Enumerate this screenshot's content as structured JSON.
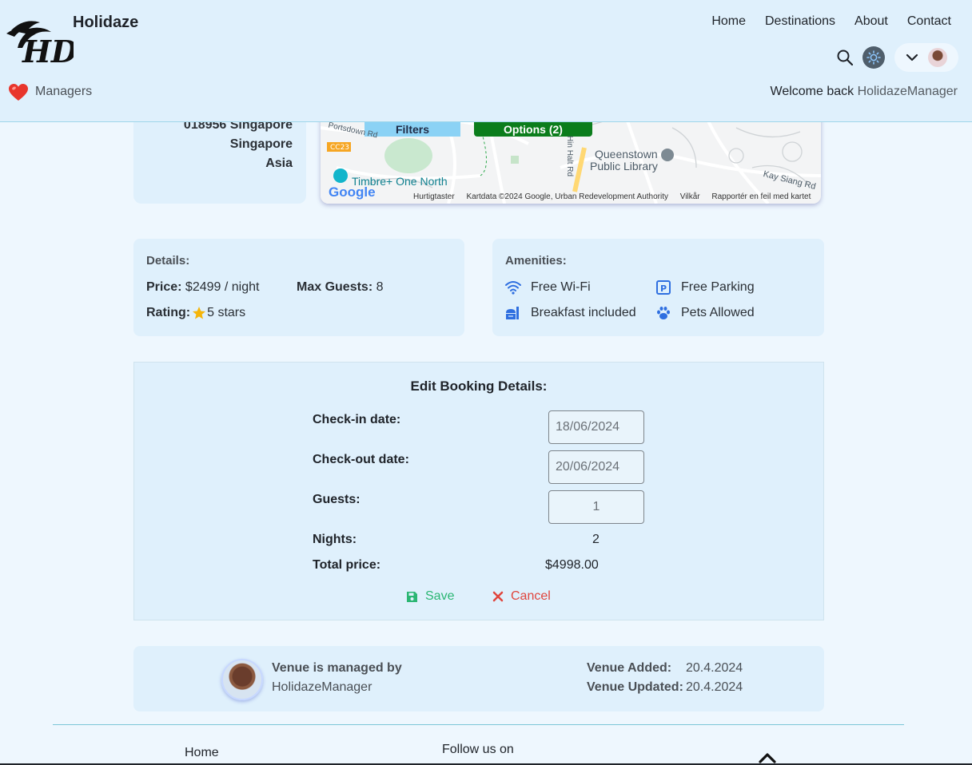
{
  "header": {
    "brand": "Holidaze",
    "logo_text": "HD",
    "nav": [
      "Home",
      "Destinations",
      "About",
      "Contact"
    ],
    "role_label": "Managers",
    "welcome_prefix": "Welcome back",
    "welcome_user": "HolidazeManager"
  },
  "address": {
    "line1": "018956 Singapore",
    "line2": "Singapore",
    "line3": "Asia"
  },
  "map": {
    "filters_label": "Filters",
    "options_label": "Options (2)",
    "place1": "Queenstown",
    "place2": "Public Library",
    "place3": "Timbre+ One North",
    "place4": "Kay Siang Rd",
    "place5": "Portsdown Rd",
    "station": "CC23",
    "road": "Hin Halt Rd",
    "google": "Google",
    "footer": [
      "Hurtigtaster",
      "Kartdata ©2024 Google, Urban Redevelopment Authority",
      "Vilkår",
      "Rapportér en feil med kartet"
    ]
  },
  "details": {
    "title": "Details:",
    "price_label": "Price:",
    "price_value": "$2499 / night",
    "guests_label": "Max Guests:",
    "guests_value": "8",
    "rating_label": "Rating:",
    "rating_value": "5 stars"
  },
  "amenities": {
    "title": "Amenities:",
    "wifi": "Free Wi-Fi",
    "parking": "Free Parking",
    "breakfast": "Breakfast included",
    "pets": "Pets Allowed"
  },
  "booking": {
    "title": "Edit Booking Details:",
    "checkin_label": "Check-in date:",
    "checkin_value": "18/06/2024",
    "checkout_label": "Check-out date:",
    "checkout_value": "20/06/2024",
    "guests_label": "Guests:",
    "guests_value": "1",
    "nights_label": "Nights:",
    "nights_value": "2",
    "total_label": "Total price:",
    "total_value": "$4998.00",
    "save_label": "Save",
    "cancel_label": "Cancel"
  },
  "manager": {
    "line1": "Venue is managed by",
    "line2": "HolidazeManager",
    "added_label": "Venue Added:",
    "added_value": "20.4.2024",
    "updated_label": "Venue Updated:",
    "updated_value": "20.4.2024"
  },
  "footer": {
    "home": "Home",
    "follow": "Follow us on"
  },
  "colors": {
    "header_bg": "#dff0fc",
    "page_bg": "#eef7fe",
    "save": "#2bb673",
    "cancel": "#e0453d",
    "options_green": "#0b7d1c",
    "filters_blue": "#8bd2f5"
  }
}
